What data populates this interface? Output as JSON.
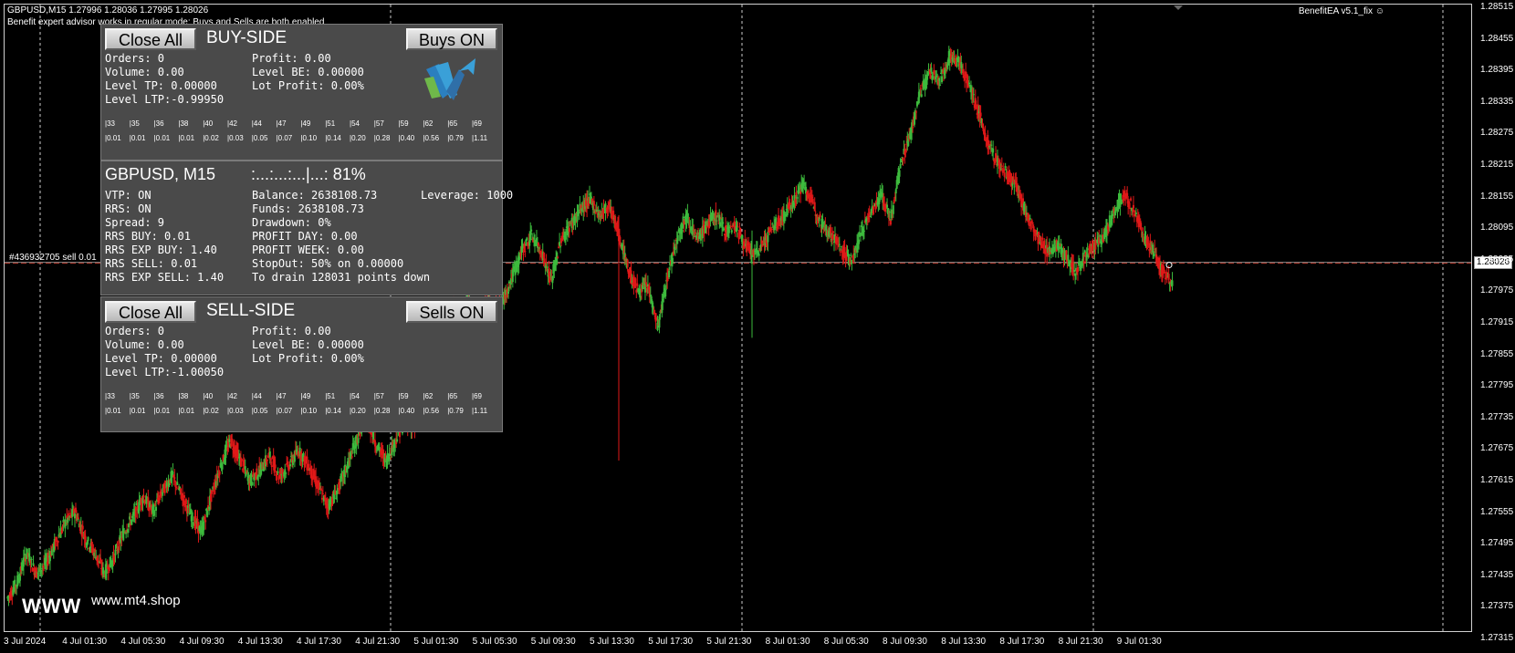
{
  "chart": {
    "symbol_line": "GBPUSD,M15  1.27996 1.28036 1.27995 1.28026",
    "ea_status": "Benefit expert advisor works in regular mode: Buys and Sells are both enabled",
    "ea_badge": "BenefitEA  v5.1_fix",
    "order_label": "#436932705 sell 0.01",
    "current_price": "1.28026",
    "y_axis": [
      "1.28515",
      "1.28455",
      "1.28395",
      "1.28335",
      "1.28275",
      "1.28215",
      "1.28155",
      "1.28095",
      "1.28035",
      "1.27975",
      "1.27915",
      "1.27855",
      "1.27795",
      "1.27735",
      "1.27675",
      "1.27615",
      "1.27555",
      "1.27495",
      "1.27435",
      "1.27375",
      "1.27315"
    ],
    "x_axis": [
      "3 Jul 2024",
      "4 Jul 01:30",
      "4 Jul 05:30",
      "4 Jul 09:30",
      "4 Jul 13:30",
      "4 Jul 17:30",
      "4 Jul 21:30",
      "5 Jul 01:30",
      "5 Jul 05:30",
      "5 Jul 09:30",
      "5 Jul 13:30",
      "5 Jul 17:30",
      "5 Jul 21:30",
      "8 Jul 01:30",
      "8 Jul 05:30",
      "8 Jul 09:30",
      "8 Jul 13:30",
      "8 Jul 17:30",
      "8 Jul 21:30",
      "9 Jul 01:30"
    ],
    "watermark_www": "WWW",
    "watermark_site": "www.mt4.shop",
    "colors": {
      "bull": "#3dba3d",
      "bear": "#e01818",
      "background": "#000000",
      "grid": "#ffffff",
      "order_line": "#c0392b"
    },
    "price_path": [
      1.2737,
      1.274,
      1.2746,
      1.2742,
      1.2744,
      1.2748,
      1.2752,
      1.2754,
      1.2749,
      1.2746,
      1.2742,
      1.2745,
      1.275,
      1.2753,
      1.2757,
      1.2754,
      1.2758,
      1.2761,
      1.2757,
      1.2753,
      1.275,
      1.2757,
      1.2763,
      1.2768,
      1.2764,
      1.276,
      1.2762,
      1.2765,
      1.2761,
      1.2763,
      1.2766,
      1.2763,
      1.2759,
      1.2755,
      1.2758,
      1.2763,
      1.2768,
      1.2773,
      1.2767,
      1.2764,
      1.2768,
      1.2772,
      1.277,
      1.2774,
      1.278,
      1.2788,
      1.2794,
      1.2791,
      1.2804,
      1.28,
      1.2793,
      1.2795,
      1.28,
      1.2805,
      1.2808,
      1.2805,
      1.2799,
      1.2807,
      1.281,
      1.2813,
      1.2815,
      1.2812,
      1.2814,
      1.2808,
      1.2801,
      1.2797,
      1.2798,
      1.279,
      1.28,
      1.2808,
      1.2812,
      1.2807,
      1.281,
      1.2812,
      1.2809,
      1.281,
      1.2806,
      1.2804,
      1.2807,
      1.281,
      1.2812,
      1.2815,
      1.2818,
      1.2814,
      1.281,
      1.2808,
      1.2805,
      1.2803,
      1.2809,
      1.2813,
      1.2816,
      1.2811,
      1.2822,
      1.2828,
      1.2836,
      1.284,
      1.2838,
      1.2843,
      1.2842,
      1.2838,
      1.2832,
      1.2826,
      1.2822,
      1.282,
      1.2817,
      1.2812,
      1.2808,
      1.2805,
      1.2806,
      1.2804,
      1.2801,
      1.2804,
      1.2806,
      1.2808,
      1.2813,
      1.2816,
      1.2813,
      1.2808,
      1.2805,
      1.2801,
      1.2799
    ]
  },
  "buy_panel": {
    "close_all": "Close All",
    "title": "BUY-SIDE",
    "toggle": "Buys ON",
    "col1": [
      "Orders: 0",
      "Volume: 0.00",
      "Level TP: 0.00000",
      "Level LTP:-0.99950"
    ],
    "col2": [
      "Profit: 0.00",
      "Level BE: 0.00000",
      "Lot Profit: 0.00%"
    ]
  },
  "status_panel": {
    "symbol": "GBPUSD, M15",
    "meter": ":...:...:...|...: 81%",
    "col1": [
      "VTP: ON",
      "RRS: ON",
      "Spread: 9",
      "RRS BUY: 0.01",
      "RRS EXP BUY: 1.40",
      "RRS SELL: 0.01",
      "RRS EXP SELL: 1.40"
    ],
    "col2": [
      "Balance: 2638108.73",
      "Funds: 2638108.73",
      "Drawdown: 0%",
      "PROFIT DAY: 0.00",
      "PROFIT WEEK: 0.00",
      "StopOut: 50% on 0.00000",
      "To drain 128031 points down"
    ],
    "leverage": "Leverage: 1000"
  },
  "sell_panel": {
    "close_all": "Close All",
    "title": "SELL-SIDE",
    "toggle": "Sells ON",
    "col1": [
      "Orders: 0",
      "Volume: 0.00",
      "Level TP: 0.00000",
      "Level LTP:-1.00050"
    ],
    "col2": [
      "Profit: 0.00",
      "Level BE: 0.00000",
      "Lot Profit: 0.00%"
    ]
  },
  "grid_levels": {
    "top": [
      "|33",
      "|35",
      "|36",
      "|38",
      "|40",
      "|42",
      "|44",
      "|47",
      "|49",
      "|51",
      "|54",
      "|57",
      "|59",
      "|62",
      "|65",
      "|69"
    ],
    "bottom": [
      "|0.01",
      "|0.01",
      "|0.01",
      "|0.01",
      "|0.02",
      "|0.03",
      "|0.05",
      "|0.07",
      "|0.10",
      "|0.14",
      "|0.20",
      "|0.28",
      "|0.40",
      "|0.56",
      "|0.79",
      "|1.11"
    ]
  }
}
